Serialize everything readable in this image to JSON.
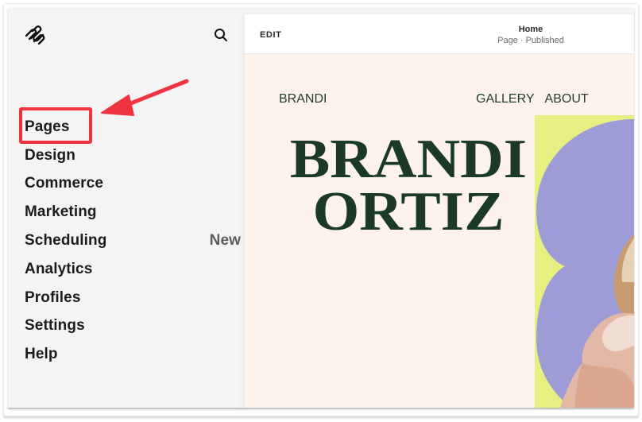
{
  "sidebar": {
    "logo": "squarespace-logo-icon",
    "search_icon": "search-icon",
    "items": [
      {
        "label": "Pages",
        "highlighted": true
      },
      {
        "label": "Design"
      },
      {
        "label": "Commerce"
      },
      {
        "label": "Marketing"
      },
      {
        "label": "Scheduling",
        "badge": "New"
      },
      {
        "label": "Analytics"
      },
      {
        "label": "Profiles"
      },
      {
        "label": "Settings"
      },
      {
        "label": "Help"
      }
    ]
  },
  "annotation": {
    "highlight_color": "#f0343f",
    "arrow_icon": "arrow-pointing-left-icon"
  },
  "editor": {
    "edit_label": "EDIT",
    "page_title": "Home",
    "page_status": "Page · Published"
  },
  "site": {
    "brand": "BRANDI",
    "nav": [
      "GALLERY",
      "ABOUT"
    ],
    "hero_lines": [
      "BRANDI",
      "ORTIZ"
    ],
    "colors": {
      "background": "#fdf3ea",
      "text": "#1b3a24",
      "accent_yellow": "#e8ef82",
      "accent_lavender": "#9e9cd6"
    }
  }
}
